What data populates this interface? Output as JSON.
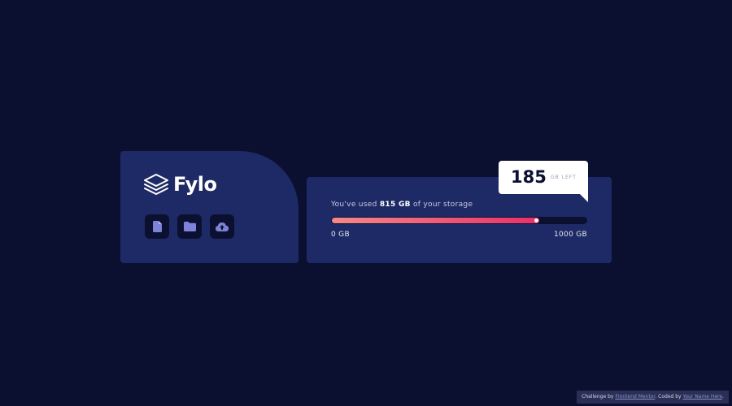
{
  "brand": {
    "name": "Fylo",
    "icons": [
      "document-icon",
      "folder-icon",
      "upload-icon"
    ]
  },
  "storage": {
    "used_prefix": "You've used ",
    "used_amount": "815 GB",
    "used_suffix": " of your storage",
    "scale_min": "0 GB",
    "scale_max": "1000 GB",
    "used_value": 815,
    "max_value": 1000
  },
  "callout": {
    "number": "185",
    "unit": "GB LEFT"
  },
  "attribution": {
    "prefix": "Challenge by ",
    "challenge_link": "Frontend Mentor",
    "middle": ". Coded by ",
    "author_link": "Your Name Here",
    "suffix": "."
  },
  "colors": {
    "background": "#0c1030",
    "card": "#1e2a65",
    "gradient_start": "#f28a8a",
    "gradient_end": "#e7306b",
    "icon_accent": "#7c83d9"
  }
}
